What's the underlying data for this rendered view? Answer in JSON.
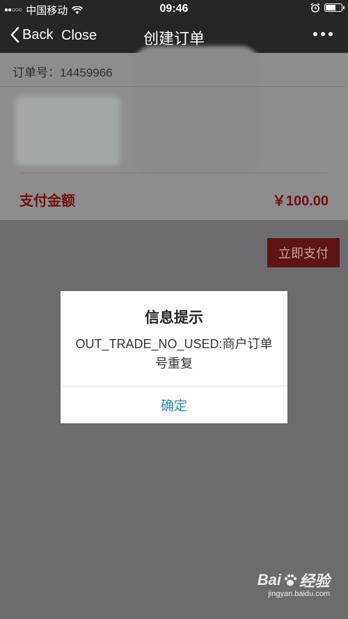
{
  "status_bar": {
    "carrier": "中国移动",
    "time": "09:46",
    "battery_level": 0.7
  },
  "nav": {
    "back_label": "Back",
    "close_label": "Close",
    "title": "创建订单"
  },
  "order": {
    "order_no": "订单号：14459966"
  },
  "payment": {
    "label": "支付金额",
    "amount": "￥100.00",
    "button_label": "立即支付"
  },
  "dialog": {
    "title": "信息提示",
    "message": "OUT_TRADE_NO_USED:商户订单号重复",
    "ok_label": "确定"
  },
  "watermark": {
    "brand_left": "Bai",
    "brand_right": "经验",
    "url": "jingyan.baidu.com"
  },
  "colors": {
    "accent_red": "#6e1311",
    "dialog_link": "#2f88a8",
    "overlay": "#6d6b6e"
  }
}
